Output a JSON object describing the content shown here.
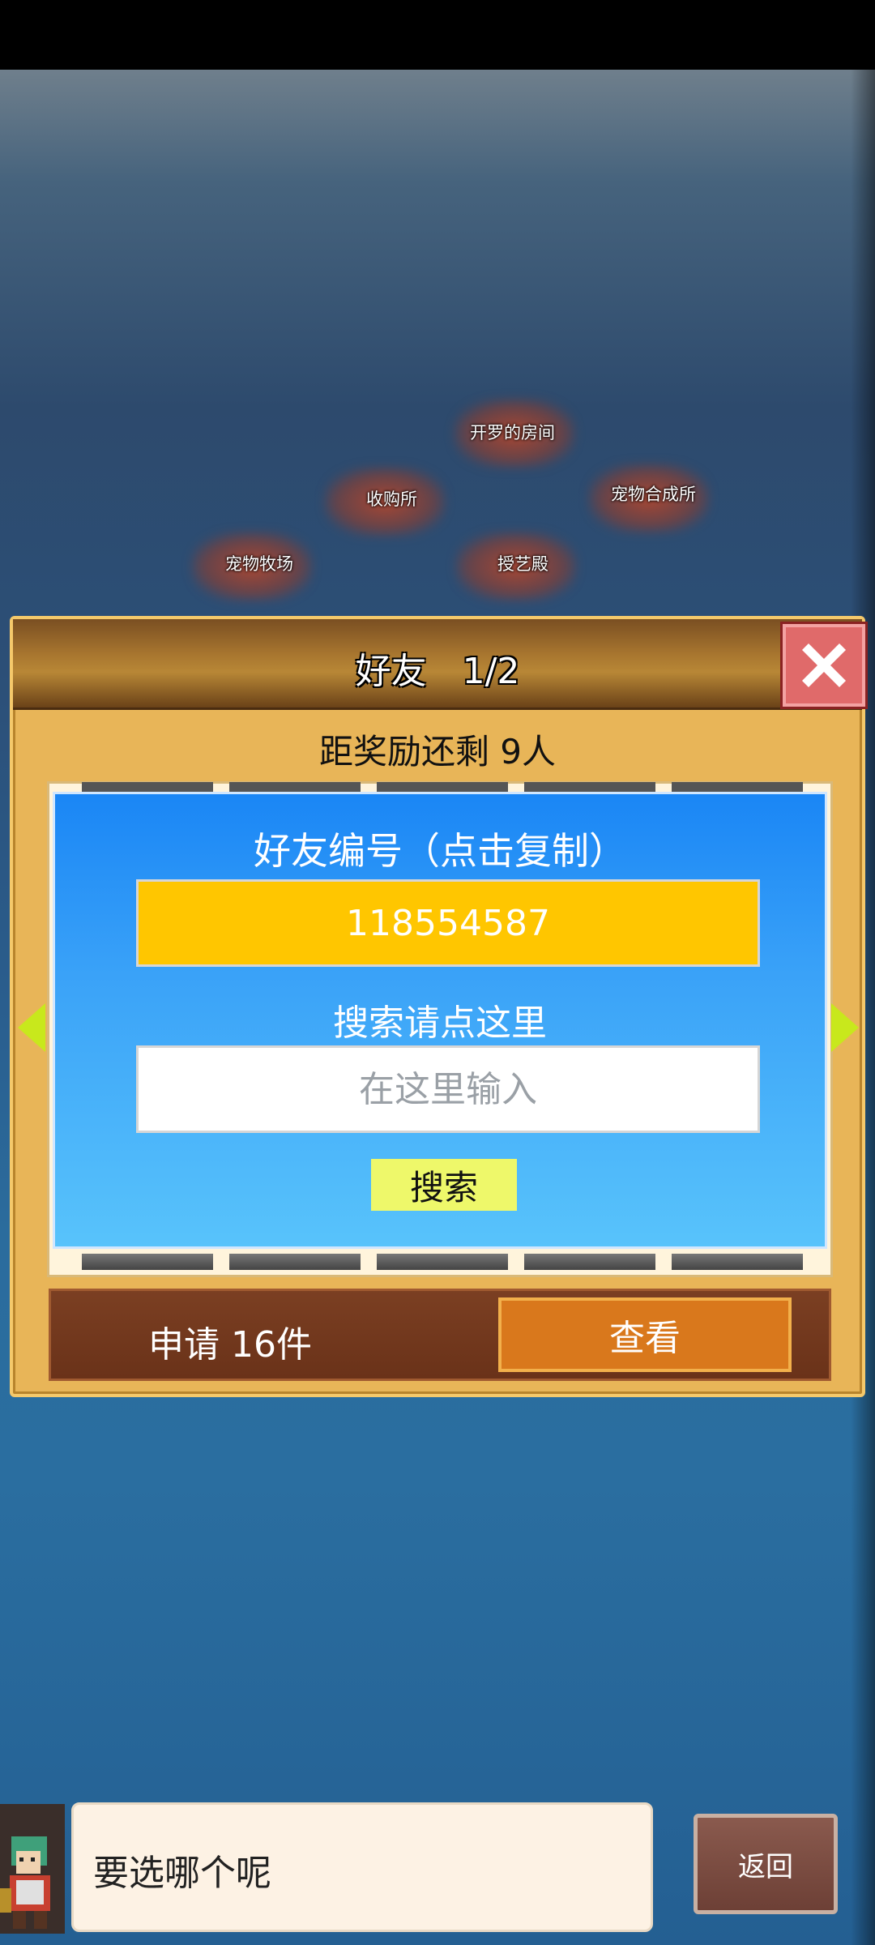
{
  "map": {
    "buildings": [
      {
        "label": "开罗的房间"
      },
      {
        "label": "收购所"
      },
      {
        "label": "宠物合成所"
      },
      {
        "label": "宠物牧场"
      },
      {
        "label": "授艺殿"
      }
    ]
  },
  "dialog": {
    "title": "好友　1/2",
    "reward_text": "距奖励还剩 9人",
    "friend_id_label": "好友编号（点击复制）",
    "friend_id": "118554587",
    "search_label": "搜索请点这里",
    "search_placeholder": "在这里输入",
    "search_button": "搜索",
    "request_text": "申请 16件",
    "view_button": "查看"
  },
  "bottom": {
    "speech_text": "要选哪个呢",
    "back_button": "返回"
  },
  "colors": {
    "panel_blue": "#1a86f5",
    "id_yellow": "#ffc600",
    "view_orange": "#d9781c",
    "close_red": "#e06a6a"
  }
}
